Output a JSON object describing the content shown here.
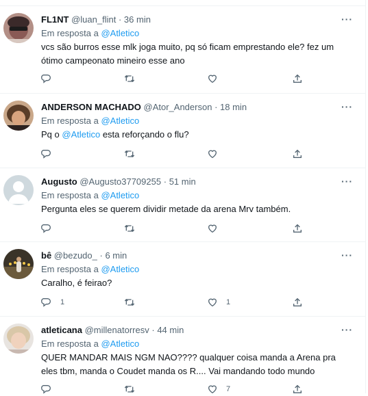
{
  "tweets": [
    {
      "display_name": "FL1NT",
      "handle": "@luan_flint",
      "time": "36 min",
      "reply_prefix": "Em resposta a",
      "reply_to": "@Atletico",
      "body_lines": [
        "vcs são burros esse mlk joga muito, pq só ficam emprestando ele? fez um",
        "ótimo campeonato mineiro esse ano"
      ],
      "reply_count": "",
      "like_count": ""
    },
    {
      "display_name": "ANDERSON MACHADO",
      "handle": "@Ator_Anderson",
      "time": "18 min",
      "reply_prefix": "Em resposta a",
      "reply_to": "@Atletico",
      "body_pre": "Pq o",
      "body_mention": "@Atletico",
      "body_post": "esta reforçando o flu?",
      "reply_count": "",
      "like_count": ""
    },
    {
      "display_name": "Augusto",
      "handle": "@Augusto37709255",
      "time": "51 min",
      "reply_prefix": "Em resposta a",
      "reply_to": "@Atletico",
      "body_lines": [
        "Pergunta eles se querem dividir metade da arena Mrv também."
      ],
      "reply_count": "",
      "like_count": ""
    },
    {
      "display_name": "bê",
      "handle": "@bezudo_",
      "time": "6 min",
      "reply_prefix": "Em resposta a",
      "reply_to": "@Atletico",
      "body_lines": [
        "Caralho, é feirao?"
      ],
      "reply_count": "1",
      "like_count": "1"
    },
    {
      "display_name": "atleticana",
      "handle": "@millenatorresv",
      "time": "44 min",
      "reply_prefix": "Em resposta a",
      "reply_to": "@Atletico",
      "body_lines": [
        "QUER MANDAR MAIS NGM NAO???? qualquer coisa manda a Arena pra",
        "eles tbm, manda o Coudet manda os R.... Vai mandando todo mundo"
      ],
      "reply_count": "",
      "like_count": "7"
    }
  ],
  "separator": "·",
  "more_icon": "more-horizontal-icon",
  "action_icons": [
    "reply-icon",
    "retweet-icon",
    "like-icon",
    "share-icon"
  ],
  "colors": {
    "link": "#1d9bf0",
    "muted": "#536471",
    "text": "#0f1419",
    "border": "#eff3f4"
  }
}
